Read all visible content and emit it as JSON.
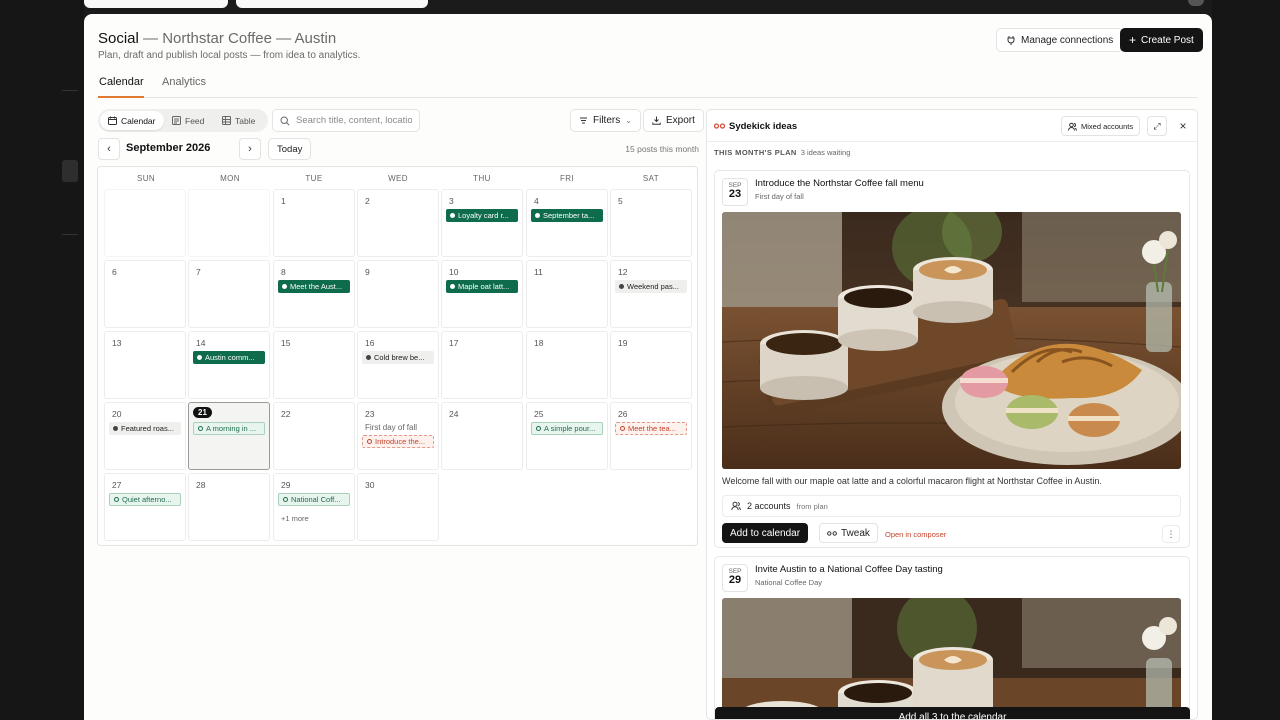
{
  "header": {
    "section": "Social",
    "separator": " — ",
    "brand": "Northstar Coffee — Austin",
    "subtitle": "Plan, draft and publish local posts — from idea to analytics.",
    "manage_connections": "Manage connections",
    "create_post": "Create Post"
  },
  "tabs": {
    "calendar": "Calendar",
    "analytics": "Analytics"
  },
  "toolbar": {
    "views": {
      "calendar": "Calendar",
      "feed": "Feed",
      "table": "Table"
    },
    "search_placeholder": "Search title, content, locatior",
    "filters": "Filters",
    "export": "Export"
  },
  "month": {
    "label": "September 2026",
    "today": "Today",
    "count": "15 posts this month"
  },
  "calendar": {
    "weekdays": [
      "SUN",
      "MON",
      "TUE",
      "WED",
      "THU",
      "FRI",
      "SAT"
    ],
    "note_23": "First day of fall",
    "more_29": "+1 more",
    "chips": {
      "d3": "Loyalty card r...",
      "d4": "September ta...",
      "d8": "Meet the Aust...",
      "d10": "Maple oat latt...",
      "d12": "Weekend pas...",
      "d14": "Austin comm...",
      "d16": "Cold brew be...",
      "d20": "Featured roas...",
      "d21": "A morning in ...",
      "d23": "Introduce the...",
      "d25": "A simple pour...",
      "d26": "Meet the tea...",
      "d27": "Quiet afterno...",
      "d29": "National Coff..."
    }
  },
  "ideas_panel": {
    "title": "Sydekick ideas",
    "accounts_mode": "Mixed accounts",
    "plan_label": "THIS MONTH'S PLAN",
    "waiting": "3 ideas waiting",
    "idea1": {
      "month": "SEP",
      "day": "23",
      "title": "Introduce the Northstar Coffee fall menu",
      "subtitle": "First day of fall",
      "description": "Welcome fall with our maple oat latte and a colorful macaron flight at Northstar Coffee in Austin.",
      "accounts": "2 accounts",
      "accounts_source": "from plan",
      "add": "Add to calendar",
      "tweak": "Tweak",
      "composer": "Open in composer"
    },
    "idea2": {
      "month": "SEP",
      "day": "29",
      "title": "Invite Austin to a National Coffee Day tasting",
      "subtitle": "National Coffee Day"
    },
    "add_all": "Add all 3 to the calendar"
  }
}
